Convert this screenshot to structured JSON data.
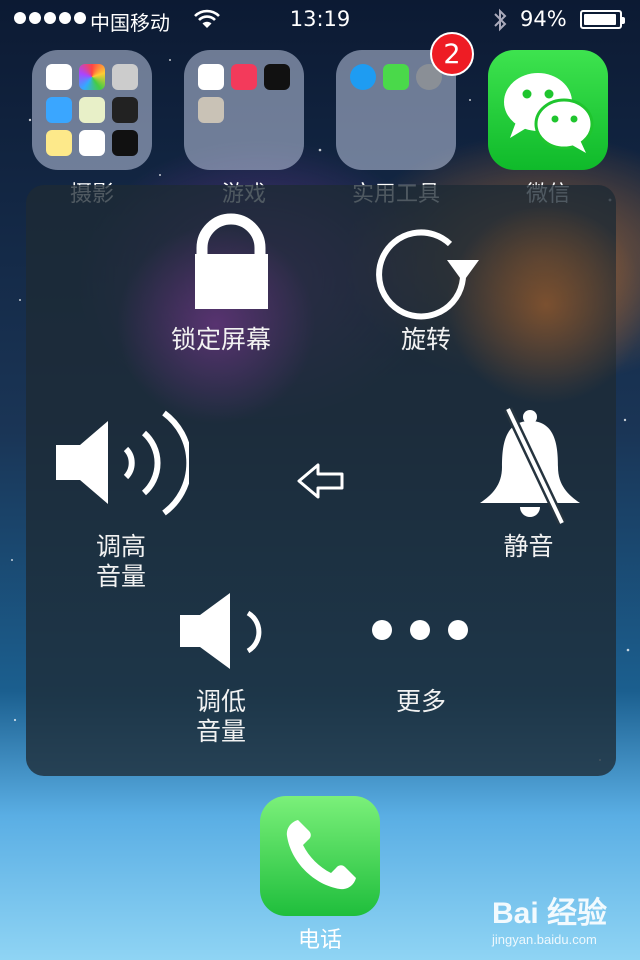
{
  "status_bar": {
    "carrier": "中国移动",
    "time": "13:19",
    "battery_percent": "94%",
    "battery_level": 0.94,
    "signal_bars": 5
  },
  "home_icons": [
    {
      "label": "摄影",
      "type": "folder"
    },
    {
      "label": "游戏",
      "type": "folder"
    },
    {
      "label": "实用工具",
      "type": "folder",
      "badge": "2"
    },
    {
      "label": "微信",
      "type": "app"
    }
  ],
  "assistive_menu": {
    "lock_screen": "锁定屏幕",
    "rotate": "旋转",
    "volume_up_line1": "调高",
    "volume_up_line2": "音量",
    "mute": "静音",
    "volume_down_line1": "调低",
    "volume_down_line2": "音量",
    "more": "更多"
  },
  "dock": {
    "phone_label": "电话"
  },
  "watermark": {
    "brand": "Bai 经验",
    "url": "jingyan.baidu.com"
  },
  "colors": {
    "badge": "#ee1c24",
    "wechat_green": "#1fc52e",
    "phone_green": "#33cc44"
  }
}
